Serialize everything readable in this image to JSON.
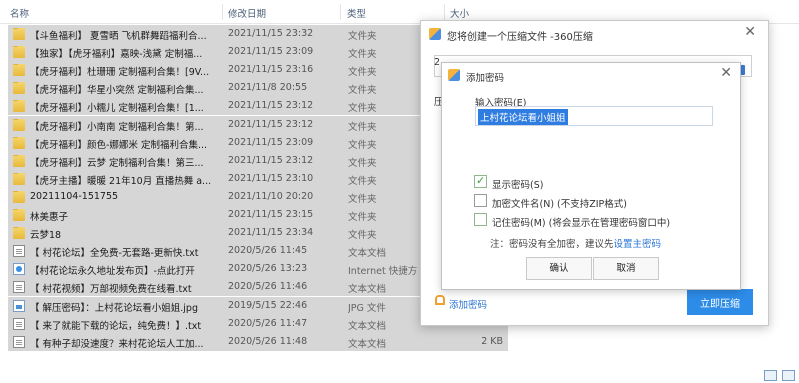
{
  "explorer": {
    "columns": {
      "name": "名称",
      "date": "修改日期",
      "type": "类型",
      "size": "大小"
    },
    "files": [
      {
        "icon": "folder",
        "name": "【斗鱼福利】 夏雪晒 飞机群舞蹈福利合...",
        "date": "2021/11/15 23:32",
        "type": "文件夹",
        "size": ""
      },
      {
        "icon": "folder",
        "name": "【独家】【虎牙福利】嘉映-浅黛 定制福...",
        "date": "2021/11/15 23:09",
        "type": "文件夹",
        "size": ""
      },
      {
        "icon": "folder",
        "name": "【虎牙福利】杜珊珊 定制福利合集！[9V...",
        "date": "2021/11/15 23:16",
        "type": "文件夹",
        "size": ""
      },
      {
        "icon": "folder",
        "name": "【虎牙福利】华星小突然 定制福利合集...",
        "date": "2021/11/8 20:55",
        "type": "文件夹",
        "size": ""
      },
      {
        "icon": "folder",
        "name": "【虎牙福利】小糯儿 定制福利合集！[1...",
        "date": "2021/11/15 23:12",
        "type": "文件夹",
        "size": ""
      },
      {
        "icon": "folder",
        "name": "【虎牙福利】小南南 定制福利合集！第...",
        "date": "2021/11/15 23:12",
        "type": "文件夹",
        "size": ""
      },
      {
        "icon": "folder",
        "name": "【虎牙福利】颜色-娜娜米 定制福利合集...",
        "date": "2021/11/15 23:09",
        "type": "文件夹",
        "size": ""
      },
      {
        "icon": "folder",
        "name": "【虎牙福利】云梦 定制福利合集！第三...",
        "date": "2021/11/15 23:12",
        "type": "文件夹",
        "size": ""
      },
      {
        "icon": "folder",
        "name": "【虎牙主播】暖暖 21年10月 直播热舞 a...",
        "date": "2021/11/15 23:10",
        "type": "文件夹",
        "size": ""
      },
      {
        "icon": "folder",
        "name": "20211104-151755",
        "date": "2021/11/10 20:20",
        "type": "文件夹",
        "size": ""
      },
      {
        "icon": "folder",
        "name": "林美惠子",
        "date": "2021/11/15 23:15",
        "type": "文件夹",
        "size": ""
      },
      {
        "icon": "folder",
        "name": "云梦18",
        "date": "2021/11/15 23:34",
        "type": "文件夹",
        "size": ""
      },
      {
        "icon": "txt",
        "name": "【 村花论坛】全免费-无套路-更新快.txt",
        "date": "2020/5/26 11:45",
        "type": "文本文档",
        "size": ""
      },
      {
        "icon": "url",
        "name": "【村花论坛永久地址发布页】-点此打开",
        "date": "2020/5/26 13:23",
        "type": "Internet 快捷方",
        "size": ""
      },
      {
        "icon": "txt",
        "name": "【 村花视频】万部视频免费在线看.txt",
        "date": "2020/5/26 11:46",
        "type": "文本文档",
        "size": ""
      },
      {
        "icon": "jpg",
        "name": "【 解压密码】：上村花论坛看小姐姐.jpg",
        "date": "2019/5/15 22:46",
        "type": "JPG 文件",
        "size": ""
      },
      {
        "icon": "txt",
        "name": "【 来了就能下载的论坛，纯免费！】.txt",
        "date": "2020/5/26 11:47",
        "type": "文本文档",
        "size": "2 KB"
      },
      {
        "icon": "txt",
        "name": "【 有种子却没速度？来村花论坛人工加...",
        "date": "2020/5/26 11:48",
        "type": "文本文档",
        "size": "2 KB"
      }
    ]
  },
  "compress_dialog": {
    "title": "您将创建一个压缩文件 -360压缩",
    "field_initial": "2",
    "label_cut": "压",
    "add_password": "添加密码",
    "compress_now": "立即压缩"
  },
  "password_dialog": {
    "title": "添加密码",
    "label": "输入密码(E)",
    "value": "上村花论坛看小姐姐",
    "show_password": "显示密码(S)",
    "encrypt_names": "加密文件名(N) (不支持ZIP格式)",
    "remember_password": "记住密码(M) (将会显示在管理密码窗口中)",
    "note": "注：密码没有全加密，建议先",
    "note_link": "设置主密码",
    "ok": "确认",
    "cancel": "取消"
  }
}
